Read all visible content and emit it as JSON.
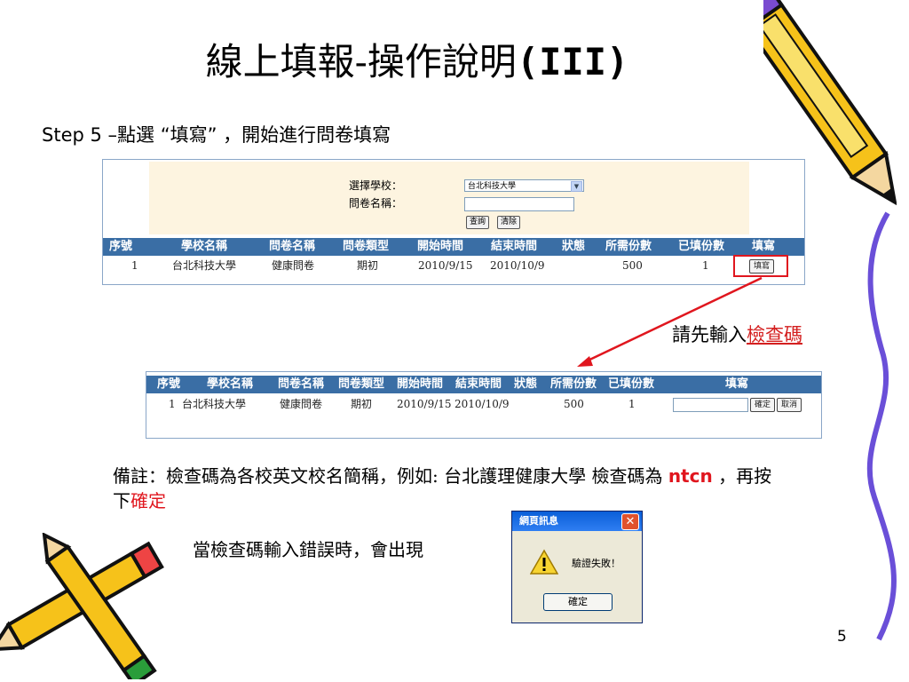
{
  "slide": {
    "title_main": "線上填報-操作說明",
    "title_suffix": "(III)",
    "step": "Step 5 –點選 “填寫” ，開始進行問卷填寫",
    "hint_prefix": "請先輸入",
    "hint_link": "檢查碼",
    "note_part1": "備註：檢查碼為各校英文校名簡稱，例如: 台北護理健康大學 檢查碼為 ",
    "note_code": "ntcn",
    "note_part2": " ，再按下",
    "note_confirm": "確定",
    "error_text": "當檢查碼輸入錯誤時，會出現",
    "page_number": "5"
  },
  "panel1": {
    "school_label": "選擇學校：",
    "school_value": "台北科技大學",
    "survey_label": "問卷名稱：",
    "survey_value": "",
    "query_button": "查詢",
    "clear_button": "清除",
    "headers": [
      "序號",
      "學校名稱",
      "問卷名稱",
      "問卷類型",
      "開始時間",
      "結束時間",
      "狀態",
      "所需份數",
      "已填份數",
      "填寫"
    ],
    "row": [
      "1",
      "台北科技大學",
      "健康問卷",
      "期初",
      "2010/9/15",
      "2010/10/9",
      "",
      "500",
      "1"
    ],
    "fill_button": "填寫"
  },
  "panel2": {
    "headers": [
      "序號",
      "學校名稱",
      "問卷名稱",
      "問卷類型",
      "開始時間",
      "結束時間",
      "狀態",
      "所需份數",
      "已填份數",
      "填寫"
    ],
    "row": [
      "1",
      "台北科技大學",
      "健康問卷",
      "期初",
      "2010/9/15",
      "2010/10/9",
      "",
      "500",
      "1"
    ],
    "code_value": "",
    "confirm_button": "確定",
    "cancel_button": "取消"
  },
  "dialog": {
    "title": "網頁訊息",
    "message": "驗證失敗！",
    "ok_button": "確定"
  },
  "colors": {
    "table_header": "#3a6ea5",
    "form_background": "#fdf4e0",
    "highlight": "#e0161e"
  }
}
